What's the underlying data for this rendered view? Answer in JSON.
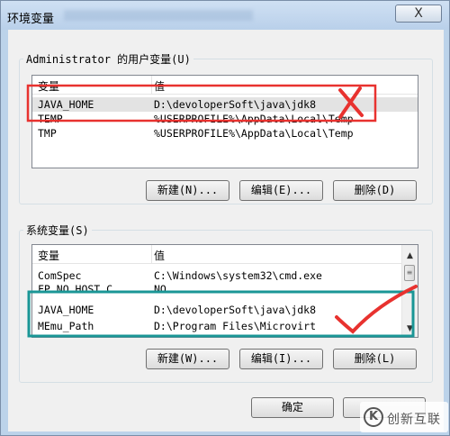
{
  "window": {
    "title": "环境变量",
    "close_label": "X"
  },
  "user_vars": {
    "group_label": "Administrator 的用户变量(U)",
    "columns": [
      "变量",
      "值"
    ],
    "rows": [
      {
        "name": "JAVA_HOME",
        "value": "D:\\devoloperSoft\\java\\jdk8"
      },
      {
        "name": "TEMP",
        "value": "%USERPROFILE%\\AppData\\Local\\Temp"
      },
      {
        "name": "TMP",
        "value": "%USERPROFILE%\\AppData\\Local\\Temp"
      }
    ],
    "buttons": {
      "new": "新建(N)...",
      "edit": "编辑(E)...",
      "delete": "删除(D)"
    }
  },
  "system_vars": {
    "group_label": "系统变量(S)",
    "columns": [
      "变量",
      "值"
    ],
    "rows": [
      {
        "name": "ComSpec",
        "value": "C:\\Windows\\system32\\cmd.exe"
      },
      {
        "name": "FP_NO_HOST_C...",
        "value": "NO"
      },
      {
        "name": "JAVA_HOME",
        "value": "D:\\devoloperSoft\\java\\jdk8"
      },
      {
        "name": "MEmu_Path",
        "value": "D:\\Program Files\\Microvirt"
      }
    ],
    "buttons": {
      "new": "新建(W)...",
      "edit": "编辑(I)...",
      "delete": "删除(L)"
    }
  },
  "footer": {
    "ok": "确定"
  },
  "watermark": {
    "icon_glyph": "K",
    "text": "创新互联"
  },
  "annotation_colors": {
    "red": "#e8322f",
    "teal": "#1a9696"
  }
}
